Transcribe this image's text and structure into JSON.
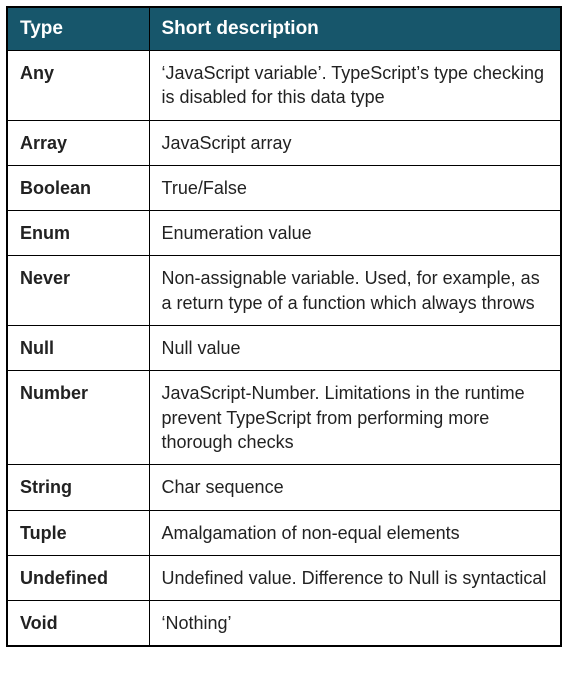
{
  "headers": {
    "type": "Type",
    "description": "Short description"
  },
  "rows": [
    {
      "type": "Any",
      "description": "‘JavaScript variable’. TypeScript’s type checking is disabled for this data type"
    },
    {
      "type": "Array",
      "description": "JavaScript array"
    },
    {
      "type": "Boolean",
      "description": "True/False"
    },
    {
      "type": "Enum",
      "description": "Enumeration value"
    },
    {
      "type": "Never",
      "description": "Non-assignable variable. Used, for example, as a return type of a function which always throws"
    },
    {
      "type": "Null",
      "description": "Null value"
    },
    {
      "type": "Number",
      "description": "JavaScript-Number. Limitations in the runtime prevent TypeScript from performing more thorough checks"
    },
    {
      "type": "String",
      "description": "Char sequence"
    },
    {
      "type": "Tuple",
      "description": "Amalgamation of non-equal elements"
    },
    {
      "type": "Undefined",
      "description": "Undefined value. Difference to Null is syntactical"
    },
    {
      "type": "Void",
      "description": "‘Nothing’"
    }
  ]
}
